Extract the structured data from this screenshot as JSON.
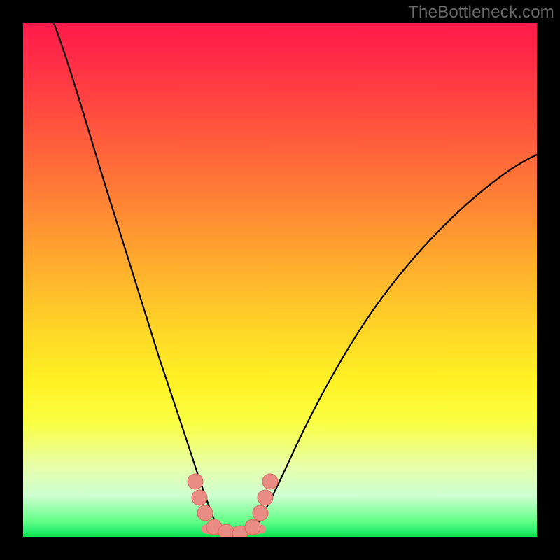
{
  "watermark": "TheBottleneck.com",
  "chart_data": {
    "type": "line",
    "title": "",
    "xlabel": "",
    "ylabel": "",
    "xlim": [
      0,
      100
    ],
    "ylim": [
      0,
      100
    ],
    "series": [
      {
        "name": "left-curve",
        "x": [
          6,
          10,
          14,
          18,
          22,
          25,
          28,
          30,
          32,
          33.5,
          35,
          36.5,
          38
        ],
        "values": [
          100,
          88,
          75,
          62,
          49,
          37,
          27,
          20,
          14,
          10,
          6,
          3,
          1
        ]
      },
      {
        "name": "right-curve",
        "x": [
          45,
          47,
          50,
          54,
          59,
          65,
          72,
          80,
          88,
          95,
          100
        ],
        "values": [
          1,
          3,
          7,
          13,
          21,
          30,
          40,
          51,
          61,
          68,
          73
        ]
      },
      {
        "name": "optimal-band-markers",
        "x": [
          33.5,
          34.5,
          35.5,
          37.5,
          39,
          41,
          43,
          44.5,
          45.5,
          46.5
        ],
        "values": [
          10,
          7,
          4.5,
          1.5,
          0.8,
          0.8,
          1.5,
          4.5,
          7,
          10
        ]
      }
    ],
    "colors": {
      "curve": "#000000",
      "marker_fill": "#e98c84",
      "marker_stroke": "#d76a60"
    }
  }
}
